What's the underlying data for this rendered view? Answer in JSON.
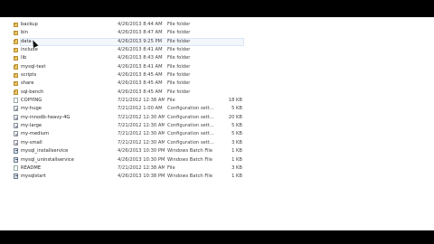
{
  "files": [
    {
      "name": "backup",
      "date": "4/26/2013 8:44 AM",
      "type": "File folder",
      "size": "",
      "icon": "folder-icon"
    },
    {
      "name": "bin",
      "date": "4/26/2013 8:47 AM",
      "type": "File folder",
      "size": "",
      "icon": "folder-icon"
    },
    {
      "name": "data",
      "date": "4/26/2013 9:25 PM",
      "type": "File folder",
      "size": "",
      "icon": "folder-icon",
      "selected": true
    },
    {
      "name": "include",
      "date": "4/26/2013 8:41 AM",
      "type": "File folder",
      "size": "",
      "icon": "folder-icon"
    },
    {
      "name": "lib",
      "date": "4/26/2013 8:43 AM",
      "type": "File folder",
      "size": "",
      "icon": "folder-icon"
    },
    {
      "name": "mysql-test",
      "date": "4/26/2013 8:41 AM",
      "type": "File folder",
      "size": "",
      "icon": "folder-icon"
    },
    {
      "name": "scripts",
      "date": "4/26/2013 8:45 AM",
      "type": "File folder",
      "size": "",
      "icon": "folder-icon"
    },
    {
      "name": "share",
      "date": "4/26/2013 8:45 AM",
      "type": "File folder",
      "size": "",
      "icon": "folder-icon"
    },
    {
      "name": "sql-bench",
      "date": "4/26/2013 8:45 AM",
      "type": "File folder",
      "size": "",
      "icon": "folder-icon"
    },
    {
      "name": "COPYING",
      "date": "7/21/2012 12:38 AM",
      "type": "File",
      "size": "18 KB",
      "icon": "file-icon"
    },
    {
      "name": "my-huge",
      "date": "7/21/2012 1:00 AM",
      "type": "Configuration sett...",
      "size": "5 KB",
      "icon": "config-file-icon"
    },
    {
      "name": "my-innodb-heavy-4G",
      "date": "7/21/2012 12:30 AM",
      "type": "Configuration sett...",
      "size": "20 KB",
      "icon": "config-file-icon"
    },
    {
      "name": "my-large",
      "date": "7/21/2012 12:30 AM",
      "type": "Configuration sett...",
      "size": "5 KB",
      "icon": "config-file-icon"
    },
    {
      "name": "my-medium",
      "date": "7/21/2012 12:30 AM",
      "type": "Configuration sett...",
      "size": "5 KB",
      "icon": "config-file-icon"
    },
    {
      "name": "my-small",
      "date": "7/21/2012 12:30 AM",
      "type": "Configuration sett...",
      "size": "3 KB",
      "icon": "config-file-icon"
    },
    {
      "name": "mysql_installservice",
      "date": "4/26/2013 10:30 PM",
      "type": "Windows Batch File",
      "size": "1 KB",
      "icon": "batch-file-icon"
    },
    {
      "name": "mysql_uninstallservice",
      "date": "4/26/2013 10:30 PM",
      "type": "Windows Batch File",
      "size": "1 KB",
      "icon": "batch-file-icon"
    },
    {
      "name": "README",
      "date": "7/21/2012 12:38 AM",
      "type": "File",
      "size": "3 KB",
      "icon": "file-icon"
    },
    {
      "name": "mysqlstart",
      "date": "4/26/2013 10:38 PM",
      "type": "Windows Batch File",
      "size": "1 KB",
      "icon": "batch-file-icon"
    }
  ]
}
